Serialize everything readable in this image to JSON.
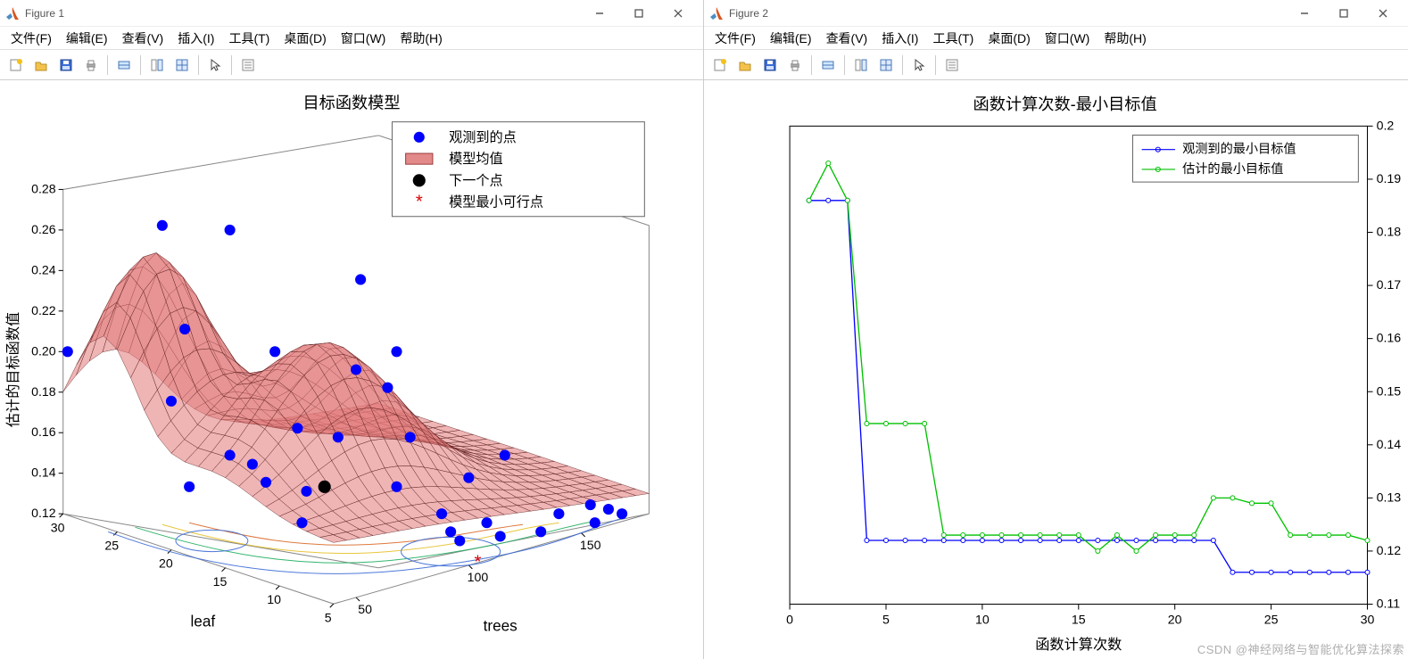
{
  "windows": [
    {
      "title": "Figure 1"
    },
    {
      "title": "Figure 2"
    }
  ],
  "menu": {
    "file": "文件(F)",
    "edit": "编辑(E)",
    "view": "查看(V)",
    "insert": "插入(I)",
    "tools": "工具(T)",
    "desktop": "桌面(D)",
    "window": "窗口(W)",
    "help": "帮助(H)"
  },
  "toolbar_icons": [
    "new",
    "open",
    "save",
    "print",
    "sep",
    "data-cursor",
    "sep",
    "link-plots",
    "sub-plot",
    "sep",
    "pointer",
    "sep",
    "properties"
  ],
  "left_plot": {
    "title": "目标函数模型",
    "zlabel": "估计的目标函数值",
    "xlabel": "leaf",
    "ylabel": "trees",
    "legend": {
      "observed": "观测到的点",
      "model_mean": "模型均值",
      "next_point": "下一个点",
      "model_min": "模型最小可行点"
    },
    "x_ticks": [
      "30",
      "25",
      "20",
      "15",
      "10",
      "5"
    ],
    "y_ticks": [
      "50",
      "100",
      "150"
    ],
    "z_ticks": [
      "0.12",
      "0.14",
      "0.16",
      "0.18",
      "0.20",
      "0.22",
      "0.24",
      "0.26",
      "0.28"
    ]
  },
  "right_plot": {
    "title": "函数计算次数-最小目标值",
    "xlabel": "函数计算次数",
    "legend": {
      "observed_min": "观测到的最小目标值",
      "estimated_min": "估计的最小目标值"
    },
    "x_ticks": [
      "0",
      "5",
      "10",
      "15",
      "20",
      "25",
      "30"
    ],
    "y_ticks": [
      "0.11",
      "0.12",
      "0.13",
      "0.14",
      "0.15",
      "0.16",
      "0.17",
      "0.18",
      "0.19",
      "0.2"
    ]
  },
  "watermark": "CSDN @神经网络与智能优化算法探索",
  "chart_data": [
    {
      "type": "3d-surface-scatter",
      "title": "目标函数模型",
      "xlabel": "leaf",
      "ylabel": "trees",
      "zlabel": "估计的目标函数值",
      "x_range": [
        5,
        30
      ],
      "y_range": [
        50,
        150
      ],
      "z_range": [
        0.12,
        0.28
      ],
      "note": "Semi-transparent red mesh surface (model mean) with blue observed scatter points, black next point, and red-star minimum marker; exact grid values not labeled in image."
    },
    {
      "type": "line",
      "title": "函数计算次数-最小目标值",
      "xlabel": "函数计算次数",
      "ylabel": "",
      "xlim": [
        0,
        30
      ],
      "ylim": [
        0.11,
        0.2
      ],
      "x": [
        1,
        2,
        3,
        4,
        5,
        6,
        7,
        8,
        9,
        10,
        11,
        12,
        13,
        14,
        15,
        16,
        17,
        18,
        19,
        20,
        21,
        22,
        23,
        24,
        25,
        26,
        27,
        28,
        29,
        30
      ],
      "series": [
        {
          "name": "观测到的最小目标值",
          "color": "#0000ff",
          "values": [
            0.186,
            0.186,
            0.186,
            0.122,
            0.122,
            0.122,
            0.122,
            0.122,
            0.122,
            0.122,
            0.122,
            0.122,
            0.122,
            0.122,
            0.122,
            0.122,
            0.122,
            0.122,
            0.122,
            0.122,
            0.122,
            0.122,
            0.116,
            0.116,
            0.116,
            0.116,
            0.116,
            0.116,
            0.116,
            0.116
          ]
        },
        {
          "name": "估计的最小目标值",
          "color": "#00c000",
          "values": [
            0.186,
            0.193,
            0.186,
            0.144,
            0.144,
            0.144,
            0.144,
            0.123,
            0.123,
            0.123,
            0.123,
            0.123,
            0.123,
            0.123,
            0.123,
            0.12,
            0.123,
            0.12,
            0.123,
            0.123,
            0.123,
            0.13,
            0.13,
            0.129,
            0.129,
            0.123,
            0.123,
            0.123,
            0.123,
            0.122
          ]
        }
      ]
    }
  ]
}
